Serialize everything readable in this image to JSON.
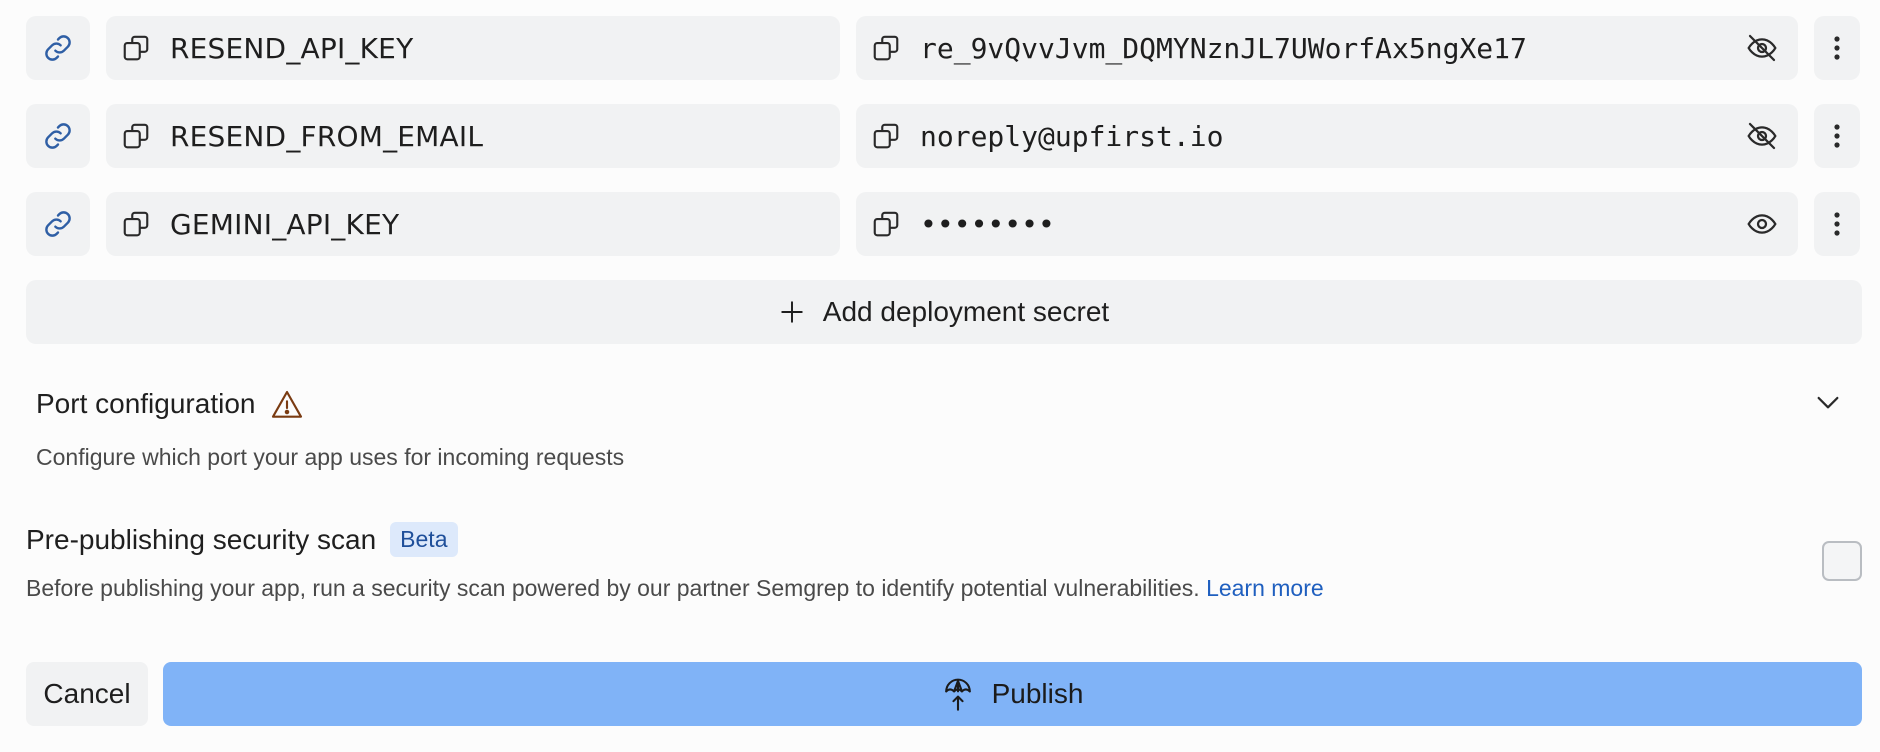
{
  "secrets": [
    {
      "name": "RESEND_API_KEY",
      "value": "re_9vQvvJvm_DQMYNznJL7UWorfAx5ngXe17",
      "visibility_icon": "eye-off-icon"
    },
    {
      "name": "RESEND_FROM_EMAIL",
      "value": "noreply@upfirst.io",
      "visibility_icon": "eye-off-icon"
    },
    {
      "name": "GEMINI_API_KEY",
      "value": "••••••••",
      "visibility_icon": "eye-icon"
    }
  ],
  "add_secret_label": "Add deployment secret",
  "port": {
    "title": "Port configuration",
    "description": "Configure which port your app uses for incoming requests"
  },
  "scan": {
    "title": "Pre-publishing security scan",
    "badge": "Beta",
    "description": "Before publishing your app, run a security scan powered by our partner Semgrep to identify potential vulnerabilities.",
    "link": "Learn more",
    "checked": false
  },
  "buttons": {
    "cancel": "Cancel",
    "publish": "Publish"
  },
  "colors": {
    "accent": "#80b3f7",
    "link": "#1f5fbf",
    "warning": "#7a3b12"
  }
}
